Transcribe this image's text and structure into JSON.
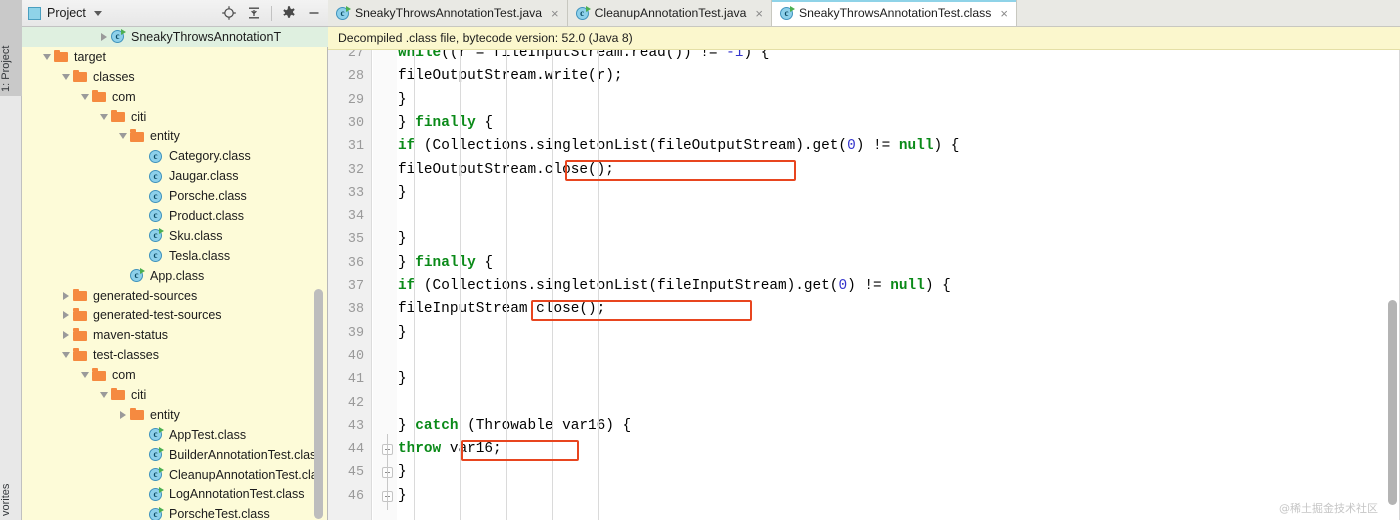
{
  "left_strip": {
    "top_tab": "1: Project",
    "bottom_tab": "vorites"
  },
  "project_panel": {
    "toolbar": {
      "title": "Project",
      "dropdown_icon": "chevron-down-icon",
      "actions": [
        {
          "name": "locate-icon",
          "tooltip": "Select Opened File"
        },
        {
          "name": "collapse-all-icon",
          "tooltip": "Collapse All"
        },
        {
          "name": "gear-icon",
          "tooltip": "Settings"
        },
        {
          "name": "minimize-icon",
          "tooltip": "Hide"
        }
      ]
    },
    "tree": [
      {
        "label": "SneakyThrowsAnnotationT",
        "indent": 4,
        "icon": "java-class-run-icon",
        "arrow": "closed",
        "selected": true
      },
      {
        "label": "target",
        "indent": 1,
        "icon": "folder-icon",
        "arrow": "open",
        "selected": false
      },
      {
        "label": "classes",
        "indent": 2,
        "icon": "folder-icon",
        "arrow": "open",
        "selected": false
      },
      {
        "label": "com",
        "indent": 3,
        "icon": "folder-icon",
        "arrow": "open",
        "selected": false
      },
      {
        "label": "citi",
        "indent": 4,
        "icon": "folder-icon",
        "arrow": "open",
        "selected": false
      },
      {
        "label": "entity",
        "indent": 5,
        "icon": "folder-icon",
        "arrow": "open",
        "selected": false
      },
      {
        "label": "Category.class",
        "indent": 6,
        "icon": "java-class-icon",
        "arrow": "none",
        "selected": false
      },
      {
        "label": "Jaugar.class",
        "indent": 6,
        "icon": "java-class-icon",
        "arrow": "none",
        "selected": false
      },
      {
        "label": "Porsche.class",
        "indent": 6,
        "icon": "java-class-icon",
        "arrow": "none",
        "selected": false
      },
      {
        "label": "Product.class",
        "indent": 6,
        "icon": "java-class-icon",
        "arrow": "none",
        "selected": false
      },
      {
        "label": "Sku.class",
        "indent": 6,
        "icon": "java-class-run-icon",
        "arrow": "none",
        "selected": false
      },
      {
        "label": "Tesla.class",
        "indent": 6,
        "icon": "java-class-icon",
        "arrow": "none",
        "selected": false
      },
      {
        "label": "App.class",
        "indent": 5,
        "icon": "java-class-run-icon",
        "arrow": "none",
        "selected": false
      },
      {
        "label": "generated-sources",
        "indent": 2,
        "icon": "folder-icon",
        "arrow": "closed",
        "selected": false
      },
      {
        "label": "generated-test-sources",
        "indent": 2,
        "icon": "folder-icon",
        "arrow": "closed",
        "selected": false
      },
      {
        "label": "maven-status",
        "indent": 2,
        "icon": "folder-icon",
        "arrow": "closed",
        "selected": false
      },
      {
        "label": "test-classes",
        "indent": 2,
        "icon": "folder-icon",
        "arrow": "open",
        "selected": false
      },
      {
        "label": "com",
        "indent": 3,
        "icon": "folder-icon",
        "arrow": "open",
        "selected": false
      },
      {
        "label": "citi",
        "indent": 4,
        "icon": "folder-icon",
        "arrow": "open",
        "selected": false
      },
      {
        "label": "entity",
        "indent": 5,
        "icon": "folder-icon",
        "arrow": "closed",
        "selected": false
      },
      {
        "label": "AppTest.class",
        "indent": 6,
        "icon": "java-class-run-icon",
        "arrow": "none",
        "selected": false
      },
      {
        "label": "BuilderAnnotationTest.class",
        "indent": 6,
        "icon": "java-class-run-icon",
        "arrow": "none",
        "selected": false
      },
      {
        "label": "CleanupAnnotationTest.cla",
        "indent": 6,
        "icon": "java-class-run-icon",
        "arrow": "none",
        "selected": false
      },
      {
        "label": "LogAnnotationTest.class",
        "indent": 6,
        "icon": "java-class-run-icon",
        "arrow": "none",
        "selected": false
      },
      {
        "label": "PorscheTest.class",
        "indent": 6,
        "icon": "java-class-run-icon",
        "arrow": "none",
        "selected": false
      }
    ]
  },
  "editor": {
    "tabs": [
      {
        "label": "SneakyThrowsAnnotationTest.java",
        "active": false,
        "icon": "java-class-run-icon",
        "close": "×"
      },
      {
        "label": "CleanupAnnotationTest.java",
        "active": false,
        "icon": "java-class-run-icon",
        "close": "×"
      },
      {
        "label": "SneakyThrowsAnnotationTest.class",
        "active": true,
        "icon": "java-class-run-icon",
        "close": "×"
      }
    ],
    "notification": "Decompiled .class file, bytecode version: 52.0 (Java 8)",
    "lines": [
      {
        "num": "27",
        "segments": [
          {
            "t": "                while",
            "c": "kw"
          },
          {
            "t": "((r = fileInputStream.read()) != ",
            "c": ""
          },
          {
            "t": "-1",
            "c": "num"
          },
          {
            "t": ") {",
            "c": ""
          }
        ],
        "clipped_top": true
      },
      {
        "num": "28",
        "segments": [
          {
            "t": "                    fileOutputStream.write(r);",
            "c": ""
          }
        ]
      },
      {
        "num": "29",
        "segments": [
          {
            "t": "                }",
            "c": ""
          }
        ]
      },
      {
        "num": "30",
        "segments": [
          {
            "t": "            } ",
            "c": ""
          },
          {
            "t": "finally",
            "c": "kw"
          },
          {
            "t": " {",
            "c": ""
          }
        ]
      },
      {
        "num": "31",
        "segments": [
          {
            "t": "                ",
            "c": ""
          },
          {
            "t": "if",
            "c": "kw"
          },
          {
            "t": " (Collections.singletonList(fileOutputStream).get(",
            "c": ""
          },
          {
            "t": "0",
            "c": "num"
          },
          {
            "t": ") != ",
            "c": ""
          },
          {
            "t": "null",
            "c": "kw"
          },
          {
            "t": ") {",
            "c": ""
          }
        ]
      },
      {
        "num": "32",
        "segments": [
          {
            "t": "                    fileOutputStream.close();",
            "c": ""
          }
        ]
      },
      {
        "num": "33",
        "segments": [
          {
            "t": "                }",
            "c": ""
          }
        ]
      },
      {
        "num": "34",
        "segments": [
          {
            "t": "",
            "c": ""
          }
        ]
      },
      {
        "num": "35",
        "segments": [
          {
            "t": "            }",
            "c": ""
          }
        ]
      },
      {
        "num": "36",
        "segments": [
          {
            "t": "        } ",
            "c": ""
          },
          {
            "t": "finally",
            "c": "kw"
          },
          {
            "t": " {",
            "c": ""
          }
        ]
      },
      {
        "num": "37",
        "segments": [
          {
            "t": "            ",
            "c": ""
          },
          {
            "t": "if",
            "c": "kw"
          },
          {
            "t": " (Collections.singletonList(fileInputStream).get(",
            "c": ""
          },
          {
            "t": "0",
            "c": "num"
          },
          {
            "t": ") != ",
            "c": ""
          },
          {
            "t": "null",
            "c": "kw"
          },
          {
            "t": ") {",
            "c": ""
          }
        ]
      },
      {
        "num": "38",
        "segments": [
          {
            "t": "                fileInputStream.close();",
            "c": ""
          }
        ]
      },
      {
        "num": "39",
        "segments": [
          {
            "t": "            }",
            "c": ""
          }
        ]
      },
      {
        "num": "40",
        "segments": [
          {
            "t": "",
            "c": ""
          }
        ]
      },
      {
        "num": "41",
        "segments": [
          {
            "t": "        }",
            "c": ""
          }
        ]
      },
      {
        "num": "42",
        "segments": [
          {
            "t": "",
            "c": ""
          }
        ]
      },
      {
        "num": "43",
        "segments": [
          {
            "t": "    } ",
            "c": ""
          },
          {
            "t": "catch",
            "c": "kw"
          },
          {
            "t": " (Throwable var16) {",
            "c": ""
          }
        ]
      },
      {
        "num": "44",
        "segments": [
          {
            "t": "        ",
            "c": ""
          },
          {
            "t": "throw",
            "c": "kw"
          },
          {
            "t": " var16;",
            "c": ""
          }
        ]
      },
      {
        "num": "45",
        "segments": [
          {
            "t": "    }",
            "c": ""
          }
        ]
      },
      {
        "num": "46",
        "segments": [
          {
            "t": "}",
            "c": ""
          }
        ]
      }
    ],
    "highlights": [
      {
        "name": "highlight-fileoutputstream-close",
        "line": "32",
        "text": "fileOutputStream.close();"
      },
      {
        "name": "highlight-fileinputstream-close",
        "line": "38",
        "text": "fileInputStream.close();"
      },
      {
        "name": "highlight-throw-var16",
        "line": "44",
        "text": "throw var16;"
      }
    ],
    "fold_markers": [
      "44",
      "45",
      "46"
    ],
    "watermark": "@稀土掘金技术社区"
  },
  "colors": {
    "highlight_border": "#e8451f",
    "keyword": "#0a8a18",
    "number": "#3333cc",
    "tree_background": "#fdfbd8",
    "notification_background": "#fbf7cd",
    "selection": "#dff0e0"
  }
}
